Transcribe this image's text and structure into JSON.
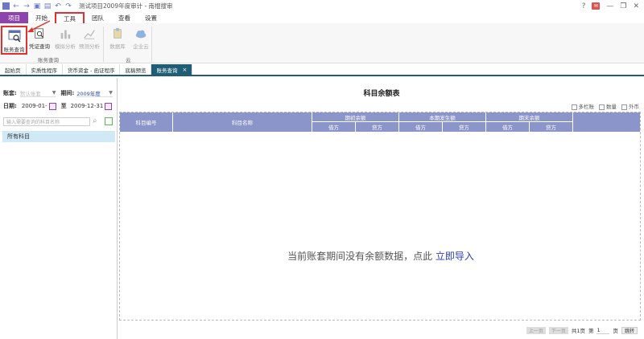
{
  "titlebar": {
    "title": "测试项目2009年度审计 - 南棍搜审"
  },
  "menu": {
    "project": "项目",
    "tabs": [
      "开始",
      "工具",
      "团队",
      "查看",
      "设置"
    ]
  },
  "ribbon": {
    "buttons": [
      "账务查询",
      "凭证查询",
      "模拟分析",
      "预测分析",
      "数据库",
      "企业云"
    ],
    "groups": [
      "账务查询",
      "云"
    ]
  },
  "doctabs": [
    "起始页",
    "实质性程序",
    "货币资金 - 函证程序",
    "底稿预览",
    "账务查询"
  ],
  "left": {
    "account_label": "账套:",
    "account_placeholder": "默认账套",
    "period_label": "期间:",
    "period_value": "2009年度",
    "date_label": "日期:",
    "date_from": "2009-01-",
    "date_to_label": "至",
    "date_to": "2009-12-31",
    "search_placeholder": "输入需要查询的科目名称",
    "tree_root": "所有科目"
  },
  "report": {
    "title": "科目余额表",
    "options": [
      "多栏账",
      "数量",
      "外币"
    ],
    "columns": {
      "code": "科目编号",
      "name": "科目名称",
      "groups": [
        "期初余额",
        "本期发生额",
        "期末余额"
      ],
      "sub": [
        "借方",
        "贷方"
      ]
    },
    "empty_text": "当前账套期间没有余额数据，点此",
    "empty_link": "立即导入"
  },
  "pager": {
    "prev": "上一页",
    "next": "下一页",
    "total": "共1页",
    "page_label": "第",
    "page_no": "1",
    "page_suffix": "页",
    "go": "跳转"
  }
}
